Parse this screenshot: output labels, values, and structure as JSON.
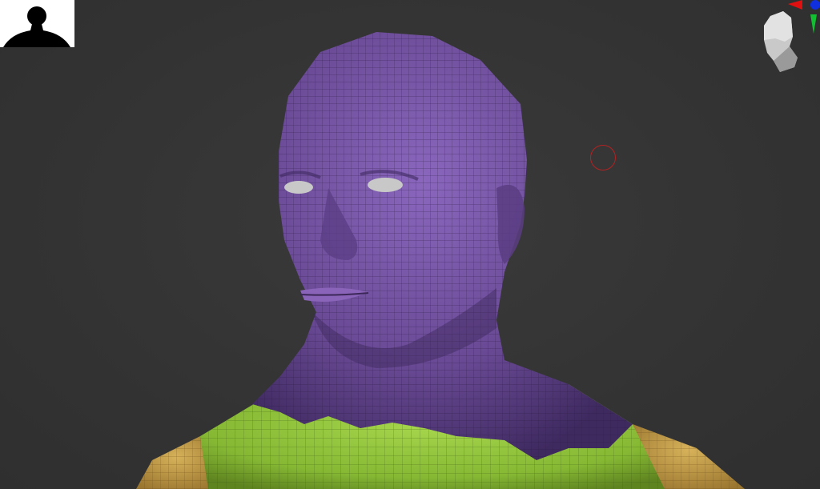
{
  "app": {
    "viewport_label": ""
  },
  "colors": {
    "background": "#343434",
    "polygroup_head": "#6a4a96",
    "polygroup_torso": "#8cbd3a",
    "polygroup_shoulder": "#c9a04a",
    "brush_cursor": "#b52222",
    "axis_x": "#e01010",
    "axis_y": "#10c030",
    "axis_z": "#1030e0"
  },
  "icons": {
    "thumbnail": "silhouette-thumbnail-icon",
    "nav_cube": "head-orientation-icon",
    "brush": "brush-cursor-icon"
  }
}
